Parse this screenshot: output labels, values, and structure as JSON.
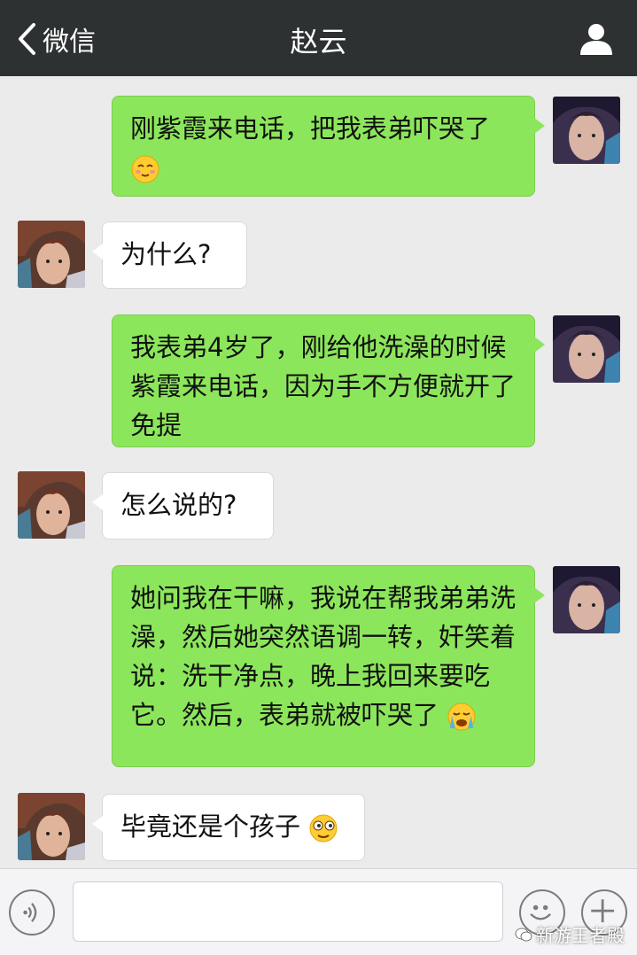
{
  "header": {
    "back_label": "微信",
    "title": "赵云"
  },
  "messages": [
    {
      "side": "out",
      "text": "刚紫霞来电话，把我表弟吓哭了",
      "emoji": "blush-emoji"
    },
    {
      "side": "in",
      "text": "为什么?"
    },
    {
      "side": "out",
      "text": "我表弟4岁了，刚给他洗澡的时候紫霞来电话，因为手不方便就开了免提"
    },
    {
      "side": "in",
      "text": "怎么说的?"
    },
    {
      "side": "out",
      "text": "她问我在干嘛，我说在帮我弟弟洗澡，然后她突然语调一转，奸笑着说：洗干净点，晚上我回来要吃它。然后，表弟就被吓哭了",
      "emoji": "crying-emoji"
    },
    {
      "side": "in",
      "text": "毕竟还是个孩子",
      "emoji": "awkward-emoji"
    }
  ],
  "input": {
    "value": "",
    "placeholder": ""
  },
  "watermark": "新游王者殿",
  "colors": {
    "header_bg": "#2e3132",
    "chat_bg": "#ebebeb",
    "out_bubble": "#8ce65b",
    "in_bubble": "#ffffff"
  }
}
